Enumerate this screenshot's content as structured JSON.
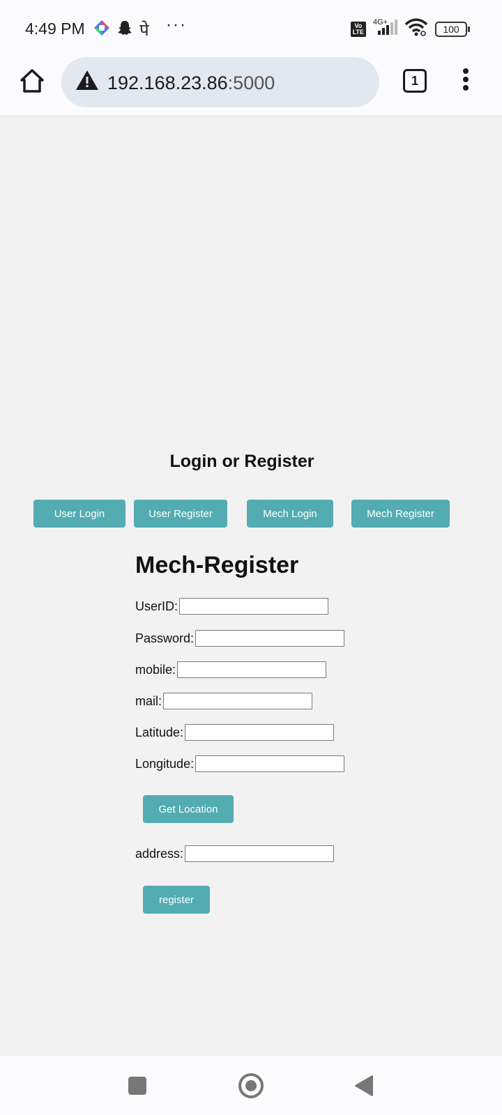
{
  "status_bar": {
    "time": "4:49 PM",
    "devanagari_glyph": "पे",
    "more": "···",
    "volte": "Vo LTE",
    "network": "4G+",
    "battery": "100"
  },
  "browser": {
    "url_host": "192.168.23.86",
    "url_port": ":5000",
    "tab_count": "1"
  },
  "page": {
    "heading": "Login or Register",
    "nav_buttons": [
      "User Login",
      "User Register",
      "Mech Login",
      "Mech Register"
    ],
    "form_title": "Mech-Register",
    "fields": [
      {
        "label": "UserID:",
        "value": ""
      },
      {
        "label": "Password:",
        "value": ""
      },
      {
        "label": "mobile:",
        "value": ""
      },
      {
        "label": "mail:",
        "value": ""
      },
      {
        "label": "Latitude:",
        "value": ""
      },
      {
        "label": "Longitude:",
        "value": ""
      },
      {
        "label": "address:",
        "value": ""
      }
    ],
    "get_location_label": "Get Location",
    "register_label": "register"
  },
  "colors": {
    "accent": "#52acb2",
    "page_bg": "#f2f2f2",
    "url_bar_bg": "#e2e8f0"
  },
  "icons": [
    "home-icon",
    "warning-icon",
    "tabs-icon",
    "more-vert-icon",
    "snapchat-icon",
    "wifi-icon",
    "signal-icon",
    "battery-icon"
  ]
}
